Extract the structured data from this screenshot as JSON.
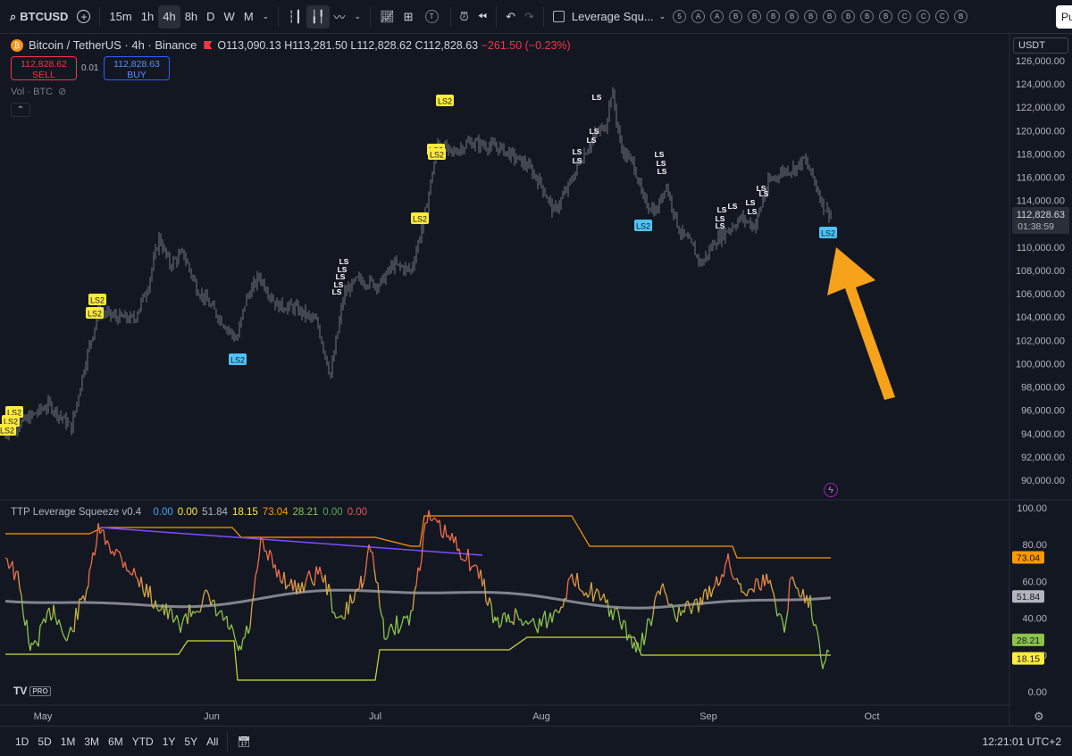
{
  "toolbar": {
    "symbol": "BTCUSD",
    "intervals": [
      "15m",
      "1h",
      "4h",
      "8h",
      "D",
      "W",
      "M"
    ],
    "active_interval": "4h",
    "indicator_name": "Leverage Squ...",
    "badges": [
      "5",
      "A",
      "A",
      "B",
      "B",
      "B",
      "B",
      "B",
      "B",
      "B",
      "B",
      "B",
      "C",
      "C",
      "C",
      "B"
    ],
    "publish_label": "Pu"
  },
  "legend": {
    "logo_glyph": "₿",
    "title": "Bitcoin / TetherUS · 4h · Binance",
    "open_label": "O",
    "open": "113,090.13",
    "high_label": "H",
    "high": "113,281.50",
    "low_label": "L",
    "low": "112,828.62",
    "close_label": "C",
    "close": "112,828.63",
    "change": "−261.50 (−0.23%)"
  },
  "trade": {
    "sell_price": "112,828.62",
    "sell_label": "SELL",
    "buy_price": "112,828.63",
    "buy_label": "BUY",
    "spread": "0.01"
  },
  "volume_label": "Vol · BTC",
  "currency_select": "USDT",
  "price_axis": {
    "ticks": [
      "126,000.00",
      "124,000.00",
      "122,000.00",
      "120,000.00",
      "118,000.00",
      "116,000.00",
      "114,000.00",
      "112,000.00",
      "110,000.00",
      "108,000.00",
      "106,000.00",
      "104,000.00",
      "102,000.00",
      "100,000.00",
      "98,000.00",
      "96,000.00",
      "94,000.00",
      "92,000.00",
      "90,000.00"
    ],
    "tick_values": [
      126000,
      124000,
      122000,
      120000,
      118000,
      116000,
      114000,
      112000,
      110000,
      108000,
      106000,
      104000,
      102000,
      100000,
      98000,
      96000,
      94000,
      92000,
      90000
    ],
    "last_price": "112,828.63",
    "countdown": "01:38:59",
    "current_value": 112828.63
  },
  "indicator": {
    "name": "TTP Leverage Squeeze v0.4",
    "values": [
      {
        "text": "0.00",
        "color": "#42a5f5"
      },
      {
        "text": "0.00",
        "color": "#ffeb3b"
      },
      {
        "text": "51.84",
        "color": "#b2b5be"
      },
      {
        "text": "18.15",
        "color": "#ffeb3b"
      },
      {
        "text": "73.04",
        "color": "#ff9800"
      },
      {
        "text": "28.21",
        "color": "#8bc34a"
      },
      {
        "text": "0.00",
        "color": "#4caf50"
      },
      {
        "text": "0.00",
        "color": "#ef5350"
      }
    ],
    "axis_ticks": [
      "100.00",
      "80.00",
      "60.00",
      "40.00",
      "20.00",
      "0.00"
    ],
    "axis_values": [
      100,
      80,
      60,
      40,
      20,
      0
    ],
    "badges": [
      {
        "text": "73.04",
        "value": 73.04,
        "bg": "#ff9800",
        "fg": "#131722"
      },
      {
        "text": "51.84",
        "value": 51.84,
        "bg": "#b2b5be",
        "fg": "#131722"
      },
      {
        "text": "28.21",
        "value": 28.21,
        "bg": "#8bc34a",
        "fg": "#131722"
      },
      {
        "text": "18.15",
        "value": 18.15,
        "bg": "#ffeb3b",
        "fg": "#131722"
      }
    ]
  },
  "time_axis": [
    "May",
    "Jun",
    "Jul",
    "Aug",
    "Sep",
    "Oct"
  ],
  "signal_labels": {
    "ls2": "LS2",
    "ls": "LS"
  },
  "tv_logo": {
    "mark": "TV",
    "pro": "PRO"
  },
  "bottom": {
    "ranges": [
      "1D",
      "5D",
      "1M",
      "3M",
      "6M",
      "YTD",
      "1Y",
      "5Y",
      "All"
    ],
    "clock": "12:21:01 UTC+2"
  },
  "colors": {
    "background": "#131722",
    "candle": "#b2b5be",
    "ls2_yellow": "#ffeb3b",
    "ls2_blue": "#4fc3f7",
    "arrow": "#f7a21b",
    "purple_line": "#7c4dff",
    "orange_line": "#ff9800",
    "gray_ma": "#9598a1"
  }
}
